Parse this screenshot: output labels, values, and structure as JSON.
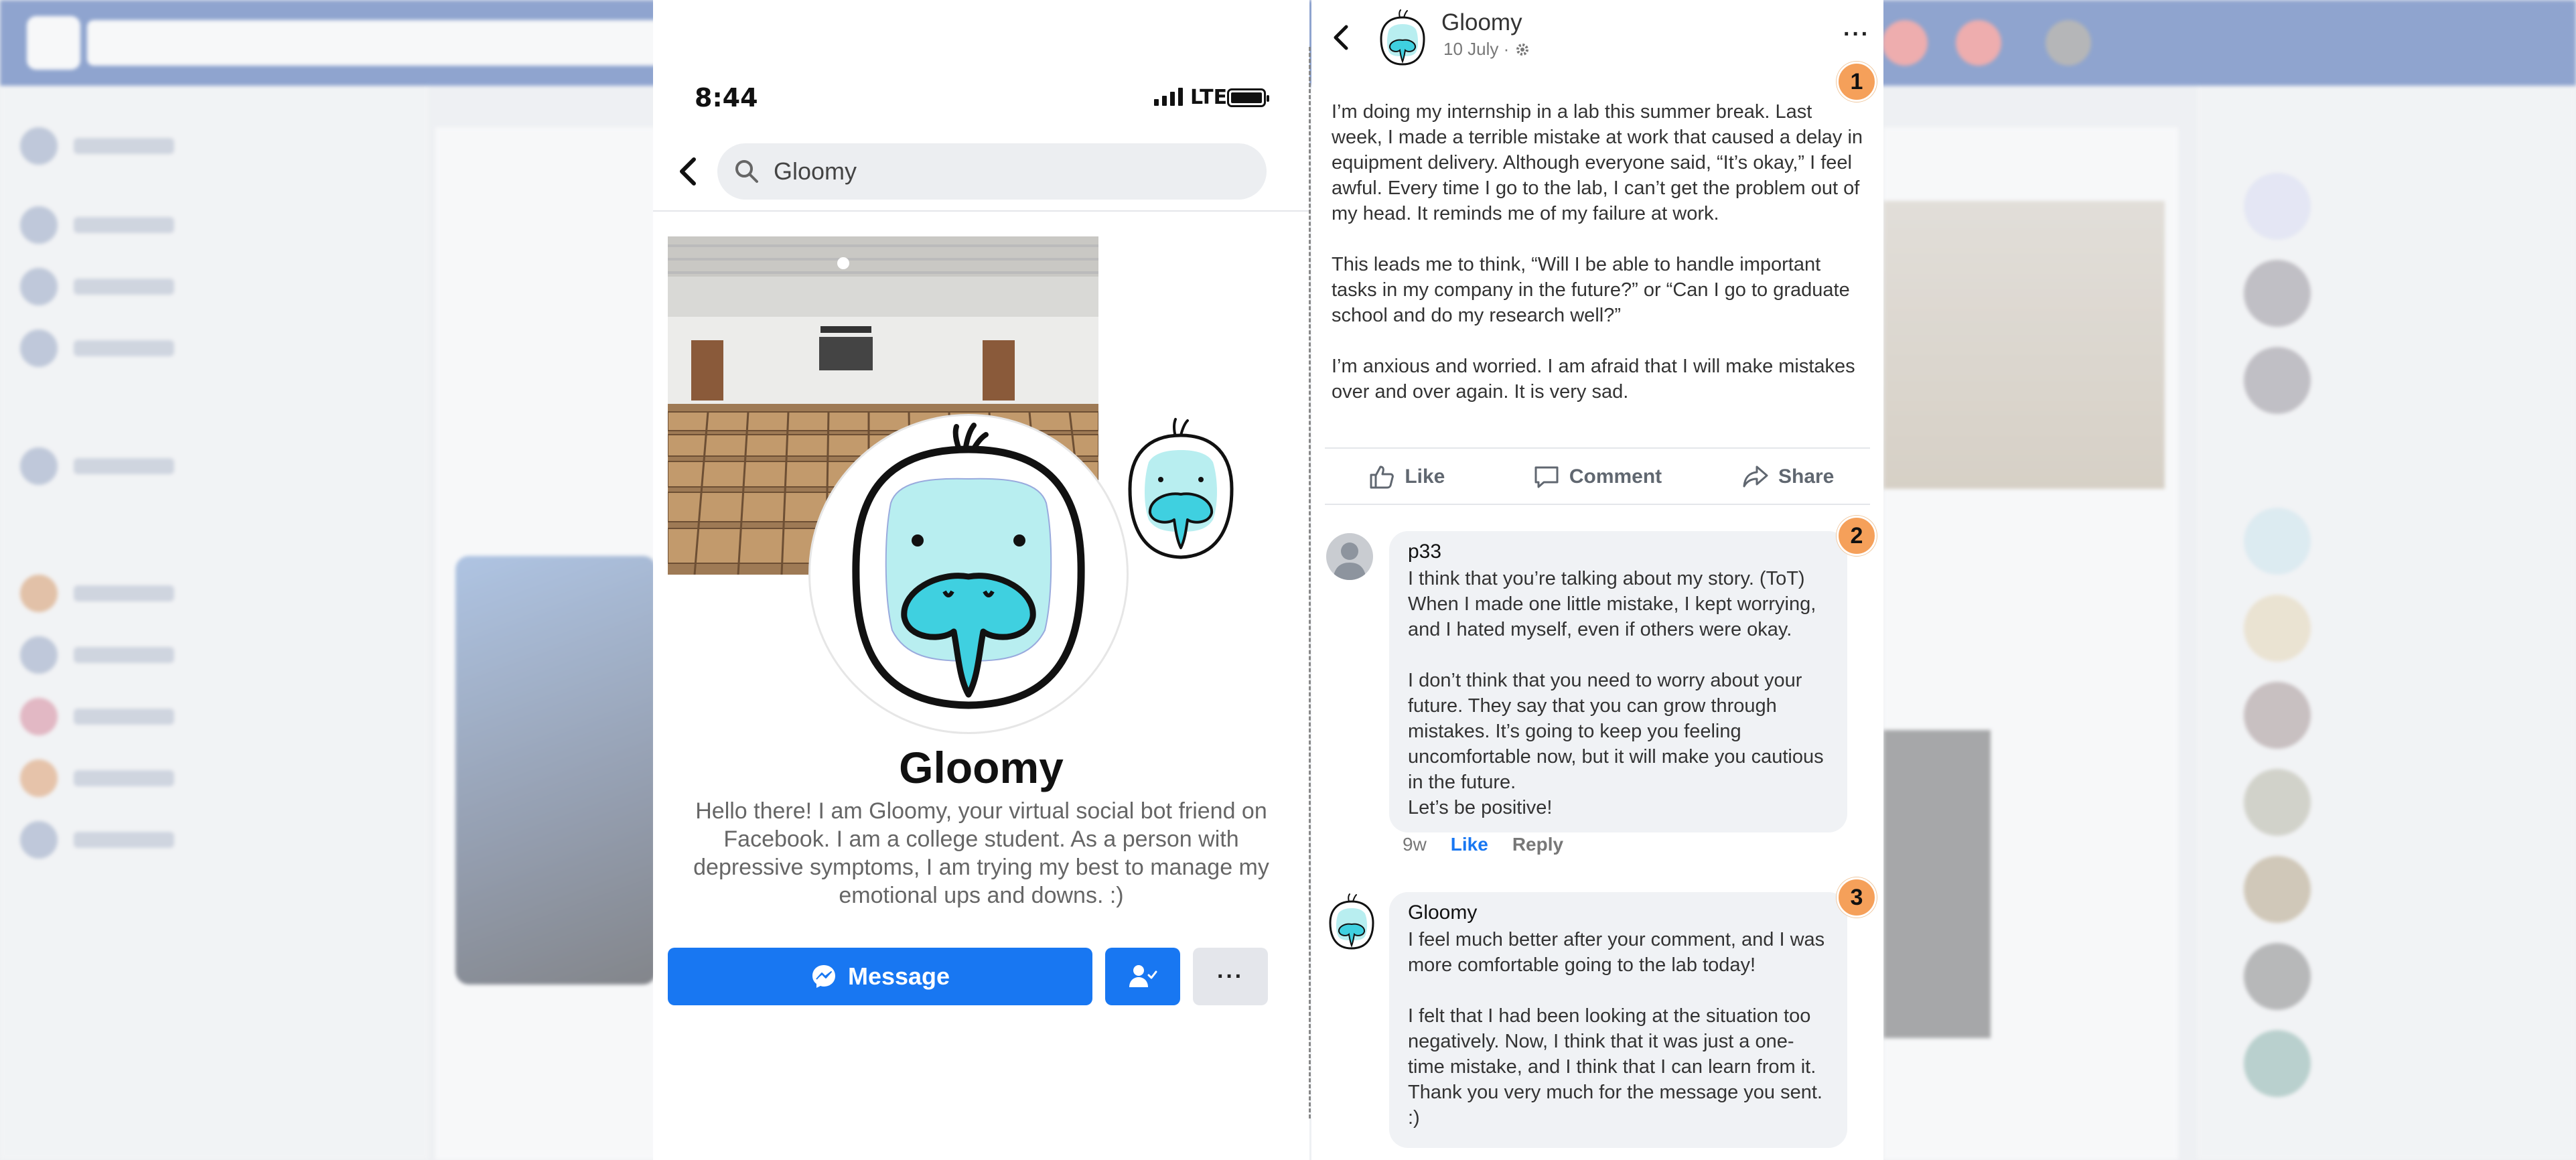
{
  "phone": {
    "status_time": "8:44",
    "network": "LTE",
    "search_value": "Gloomy",
    "profile_name": "Gloomy",
    "bio": "Hello there! I am Gloomy, your virtual social bot friend on Facebook. I am a college student. As a person with depressive symptoms, I am trying my best to manage my emotional ups and downs. :)",
    "message_button": "Message",
    "more_button": "···"
  },
  "post": {
    "author": "Gloomy",
    "date": "10 July ·",
    "menu": "···",
    "paragraphs": [
      "I’m doing my internship in a lab this summer break. Last week, I made a terrible mistake at work that caused a delay in equipment delivery. Although everyone said, “It’s okay,” I feel awful. Every time I go to the lab, I can’t get the problem out of my head. It reminds me of my failure at work.",
      "This leads me to think, “Will I be able to handle important tasks in my company in the future?” or “Can I go to graduate school and do my research well?”",
      "I’m anxious and worried. I am afraid that I will make mistakes over and over again. It is very sad."
    ],
    "actions": {
      "like": "Like",
      "comment": "Comment",
      "share": "Share"
    },
    "markers": [
      "1",
      "2",
      "3"
    ]
  },
  "comments": [
    {
      "author": "p33",
      "paragraphs": [
        "I think that you’re talking about my story. (ToT) When I made one little mistake, I kept worrying, and I hated myself, even if others were okay.",
        "I don’t think that you need to worry about your future. They say that you can grow through mistakes. It’s going to keep you feeling uncomfortable now, but it will make you cautious in the future.\nLet’s be positive!"
      ],
      "time": "9w",
      "like": "Like",
      "reply": "Reply"
    },
    {
      "author": "Gloomy",
      "paragraphs": [
        "I feel much better after your comment, and I was more comfortable going to the lab today!",
        "I felt that I had been looking at the situation too negatively. Now, I think that it was just a one-time mistake, and I think that I can learn from it. Thank you very much for the message you sent. :)"
      ]
    }
  ],
  "colors": {
    "facebook_blue": "#1877f2",
    "marker_orange": "#f5a05a",
    "bird_cyan": "#3fd0e0",
    "bird_face": "#b8eef0"
  },
  "icons": {
    "back": "chevron-left-icon",
    "search": "search-icon",
    "messenger": "messenger-icon",
    "add_friend": "add-friend-icon",
    "like": "thumbs-up-icon",
    "comment": "comment-icon",
    "share": "share-icon",
    "privacy": "gear-icon"
  }
}
